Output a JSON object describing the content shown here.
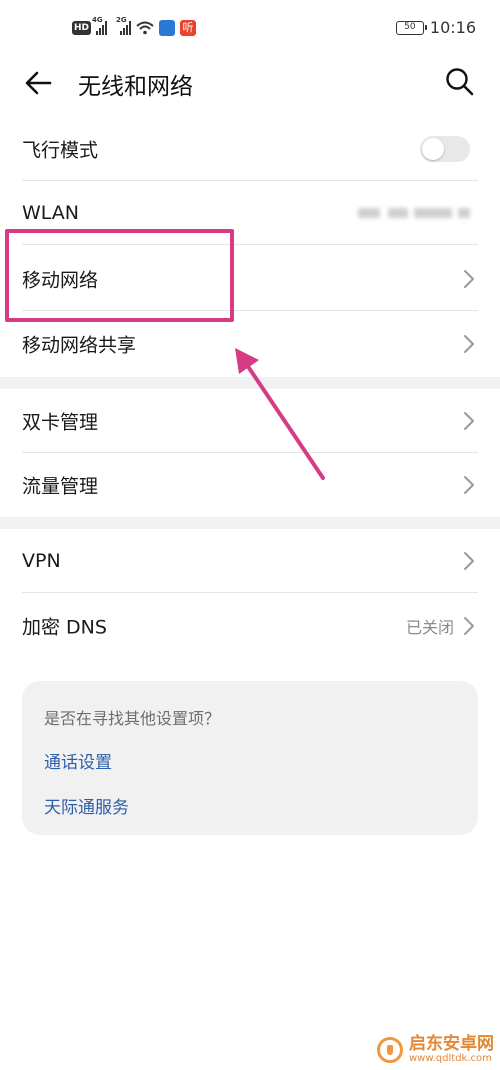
{
  "status_bar": {
    "hd": "HD",
    "sim1_tag": "4G",
    "sim2_tag": "2G",
    "battery": "50",
    "time": "10:16",
    "app_badge_text": "听"
  },
  "header": {
    "title": "无线和网络"
  },
  "settings": {
    "airplane": {
      "label": "飞行模式",
      "enabled": false
    },
    "wlan": {
      "label": "WLAN"
    },
    "mobile_network": {
      "label": "移动网络"
    },
    "tethering": {
      "label": "移动网络共享"
    },
    "dual_sim": {
      "label": "双卡管理"
    },
    "data_usage": {
      "label": "流量管理"
    },
    "vpn": {
      "label": "VPN"
    },
    "private_dns": {
      "label": "加密 DNS",
      "value": "已关闭"
    }
  },
  "suggestions": {
    "title": "是否在寻找其他设置项？",
    "links": [
      "通话设置",
      "天际通服务"
    ]
  },
  "watermark": {
    "name": "启东安卓网",
    "url": "www.qdltdk.com"
  },
  "colors": {
    "highlight": "#d63b84",
    "link": "#2f5ea9"
  }
}
